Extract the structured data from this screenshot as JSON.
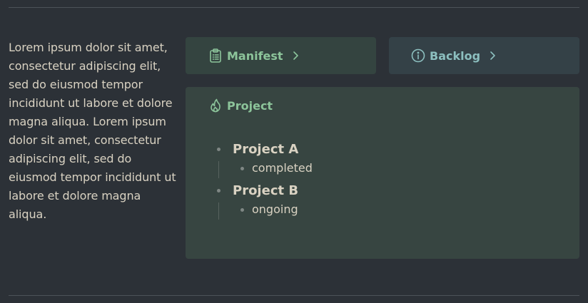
{
  "intro": {
    "text": "Lorem ipsum dolor sit amet, consectetur adipiscing elit, sed do eiusmod tempor incididunt ut labore et dolore magna aliqua. Lorem ipsum dolor sit amet, consectetur adipiscing elit, sed do eiusmod tempor incididunt ut labore et dolore magna aliqua."
  },
  "cards": {
    "manifest": {
      "label": "Manifest",
      "icon": "clipboard-list-icon",
      "color": "#8cc49a"
    },
    "backlog": {
      "label": "Backlog",
      "icon": "info-circle-icon",
      "color": "#8cbfbf"
    }
  },
  "project_panel": {
    "title": "Project",
    "icon": "flame-icon",
    "items": [
      {
        "title": "Project A",
        "status": "completed"
      },
      {
        "title": "Project B",
        "status": "ongoing"
      }
    ]
  },
  "colors": {
    "background": "#2c3137",
    "text": "#d9d2c2",
    "green_accent": "#8cc49a",
    "teal_accent": "#8cbfbf"
  }
}
